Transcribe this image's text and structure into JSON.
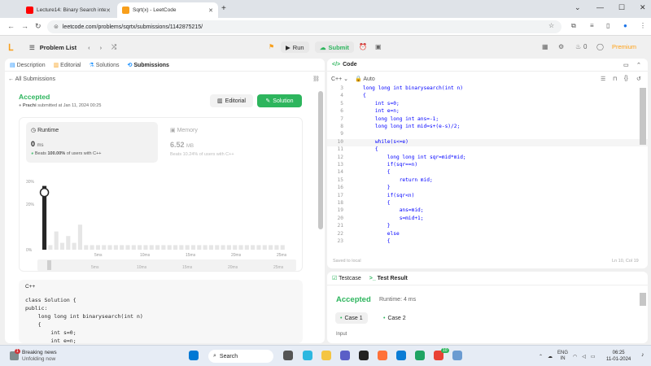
{
  "browser": {
    "tabs": [
      {
        "title": "Lecture14: Binary Search interv...",
        "color": "#ff0000"
      },
      {
        "title": "Sqrt(x) - LeetCode",
        "color": "#f89f1b"
      }
    ],
    "url": "leetcode.com/problems/sqrtx/submissions/1142875215/"
  },
  "toolbar": {
    "problem_list": "Problem List",
    "run": "Run",
    "submit": "Submit",
    "streak": "0",
    "premium": "Premium"
  },
  "left": {
    "tabs": [
      "Description",
      "Editorial",
      "Solutions",
      "Submissions"
    ],
    "all_submissions": "All Submissions",
    "status": "Accepted",
    "user": "Prachi",
    "submitted": "submitted at Jan 11, 2024 00:25",
    "editorial_btn": "Editorial",
    "solution_btn": "Solution",
    "runtime_label": "Runtime",
    "runtime_value": "0",
    "runtime_unit": "ms",
    "runtime_beats_prefix": "Beats",
    "runtime_beats": "100.00%",
    "runtime_beats_suffix": "of users with C++",
    "memory_label": "Memory",
    "memory_value": "6.52",
    "memory_unit": "MB",
    "memory_beats": "Beats 10.24% of users with C++",
    "code_lang": "C++",
    "code_lines": [
      "class Solution {",
      "public:",
      "    long long int binarysearch(int n)",
      "    {",
      "        int s=0;",
      "        int e=n;"
    ]
  },
  "chart_data": {
    "type": "bar",
    "title": "",
    "xlabel": "",
    "ylabel": "",
    "yticks": [
      "30%",
      "20%",
      "0%"
    ],
    "xticks": [
      "5ms",
      "10ms",
      "15ms",
      "20ms",
      "25ms"
    ],
    "ylim": [
      0,
      30
    ],
    "values": [
      28,
      2,
      8,
      3,
      6,
      3,
      11,
      2,
      2,
      2,
      2,
      2,
      2,
      2,
      2,
      2,
      2,
      2,
      2,
      2,
      2,
      2,
      2,
      2,
      2,
      2,
      2,
      2,
      2,
      2,
      2,
      2,
      2,
      2,
      2,
      2,
      2,
      2,
      2,
      2,
      2
    ],
    "highlight_index": 0
  },
  "right": {
    "title": "Code",
    "lang": "C++",
    "mode": "Auto",
    "lines": [
      {
        "n": "3",
        "t": "long long int binarysearch(int n)"
      },
      {
        "n": "4",
        "t": "{"
      },
      {
        "n": "5",
        "t": "    int s=0;"
      },
      {
        "n": "6",
        "t": "    int e=n;"
      },
      {
        "n": "7",
        "t": "    long long int ans=-1;"
      },
      {
        "n": "8",
        "t": "    long long int mid=s+(e-s)/2;"
      },
      {
        "n": "9",
        "t": ""
      },
      {
        "n": "10",
        "t": "    while(s<=e)"
      },
      {
        "n": "11",
        "t": "    {"
      },
      {
        "n": "12",
        "t": "        long long int sqr=mid*mid;"
      },
      {
        "n": "13",
        "t": "        if(sqr==n)"
      },
      {
        "n": "14",
        "t": "        {"
      },
      {
        "n": "15",
        "t": "            return mid;"
      },
      {
        "n": "16",
        "t": "        }"
      },
      {
        "n": "17",
        "t": "        if(sqr<n)"
      },
      {
        "n": "18",
        "t": "        {"
      },
      {
        "n": "19",
        "t": "            ans=mid;"
      },
      {
        "n": "20",
        "t": "            s=mid+1;"
      },
      {
        "n": "21",
        "t": "        }"
      },
      {
        "n": "22",
        "t": "        else"
      },
      {
        "n": "23",
        "t": "        {"
      }
    ],
    "saved": "Saved to local",
    "cursor": "Ln 10, Col 19"
  },
  "bottom": {
    "tab_testcase": "Testcase",
    "tab_result": "Test Result",
    "status": "Accepted",
    "runtime": "Runtime: 4 ms",
    "case1": "Case 1",
    "case2": "Case 2",
    "input": "Input"
  },
  "taskbar": {
    "news_title": "Breaking news",
    "news_sub": "Unfolding now",
    "search": "Search",
    "lang": "ENG",
    "region": "IN",
    "time": "06:25",
    "date": "11-01-2024",
    "badge": "1",
    "chrome_badge": "10"
  }
}
